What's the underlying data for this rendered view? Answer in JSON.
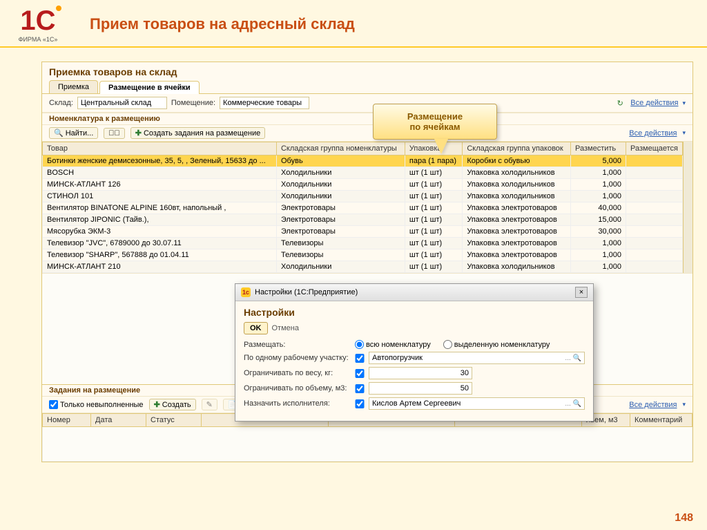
{
  "page": {
    "logo_top": "1С",
    "logo_sub": "ФИРМА «1С»",
    "title": "Прием товаров на адресный склад",
    "page_number": "148"
  },
  "callout": {
    "line1": "Размещение",
    "line2": "по ячейкам"
  },
  "app": {
    "window_title": "Приемка товаров на склад",
    "tabs": [
      "Приемка",
      "Размещение в ячейки"
    ],
    "active_tab": 1,
    "bar": {
      "warehouse_label": "Склад:",
      "warehouse_value": "Центральный склад",
      "room_label": "Помещение:",
      "room_value": "Коммерческие товары",
      "all_actions": "Все действия"
    },
    "section_nomenclature": "Номенклатура к размещению",
    "tb_find": "Найти...",
    "tb_create_tasks": "Создать задания на размещение",
    "columns": [
      "Товар",
      "Складская группа номенклатуры",
      "Упаковка",
      "Складская группа упаковок",
      "Разместить",
      "Размещается"
    ],
    "rows": [
      {
        "t": "Ботинки женские демисезонные, 35, 5, , Зеленый, 15633 до ...",
        "g": "Обувь",
        "p": "пара (1 пара)",
        "pg": "Коробки с обувью",
        "q": "5,000",
        "r": ""
      },
      {
        "t": "BOSCH",
        "g": "Холодильники",
        "p": "шт (1 шт)",
        "pg": "Упаковка холодильников",
        "q": "1,000",
        "r": ""
      },
      {
        "t": "МИНСК-АТЛАНТ 126",
        "g": "Холодильники",
        "p": "шт (1 шт)",
        "pg": "Упаковка холодильников",
        "q": "1,000",
        "r": ""
      },
      {
        "t": "СТИНОЛ 101",
        "g": "Холодильники",
        "p": "шт (1 шт)",
        "pg": "Упаковка холодильников",
        "q": "1,000",
        "r": ""
      },
      {
        "t": "Вентилятор BINATONE ALPINE 160вт, напольный ,",
        "g": "Электротовары",
        "p": "шт (1 шт)",
        "pg": "Упаковка электротоваров",
        "q": "40,000",
        "r": ""
      },
      {
        "t": "Вентилятор JIPONIC (Тайв.),",
        "g": "Электротовары",
        "p": "шт (1 шт)",
        "pg": "Упаковка электротоваров",
        "q": "15,000",
        "r": ""
      },
      {
        "t": "Мясорубка ЭКМ-3",
        "g": "Электротовары",
        "p": "шт (1 шт)",
        "pg": "Упаковка электротоваров",
        "q": "30,000",
        "r": ""
      },
      {
        "t": "Телевизор \"JVC\", 6789000 до 30.07.11",
        "g": "Телевизоры",
        "p": "шт (1 шт)",
        "pg": "Упаковка электротоваров",
        "q": "1,000",
        "r": ""
      },
      {
        "t": "Телевизор \"SHARP\", 567888 до 01.04.11",
        "g": "Телевизоры",
        "p": "шт (1 шт)",
        "pg": "Упаковка электротоваров",
        "q": "1,000",
        "r": ""
      },
      {
        "t": "МИНСК-АТЛАНТ 210",
        "g": "Холодильники",
        "p": "шт (1 шт)",
        "pg": "Упаковка холодильников",
        "q": "1,000",
        "r": ""
      }
    ],
    "section_tasks": "Задания на размещение",
    "tasks_toolbar": {
      "only_unfinished": "Только невыполненные",
      "create": "Создать"
    },
    "task_columns": [
      "Номер",
      "Дата",
      "Статус",
      "",
      "",
      "",
      "льем, м3",
      "Комментарий"
    ]
  },
  "dialog": {
    "title": "Настройки  (1С:Предприятие)",
    "heading": "Настройки",
    "ok": "OK",
    "cancel": "Отмена",
    "place_label": "Размещать:",
    "radio_all": "всю номенклатуру",
    "radio_sel": "выделенную номенклатуру",
    "by_workstation_label": "По одному рабочему участку:",
    "by_workstation_value": "Автопогрузчик",
    "limit_weight_label": "Ограничивать по весу, кг:",
    "limit_weight_value": "30",
    "limit_volume_label": "Ограничивать по объему, м3:",
    "limit_volume_value": "50",
    "executor_label": "Назначить исполнителя:",
    "executor_value": "Кислов Артем Сергеевич"
  }
}
